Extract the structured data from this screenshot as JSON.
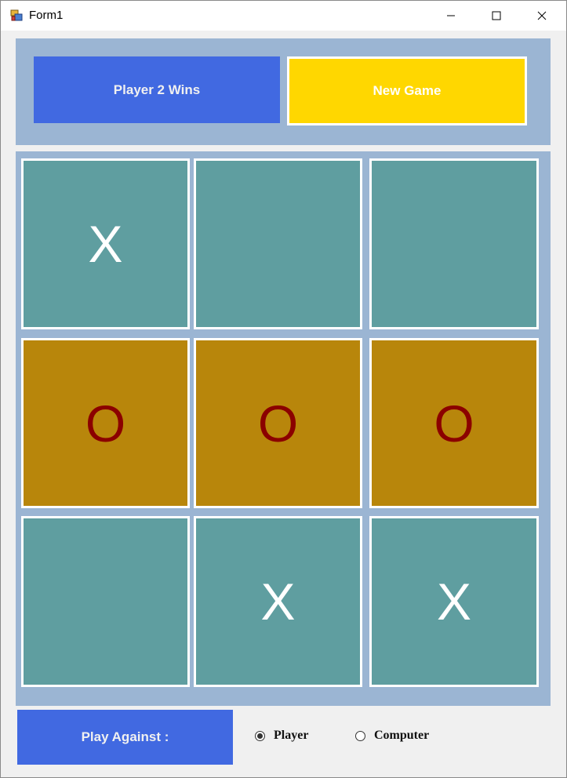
{
  "window": {
    "title": "Form1",
    "icon": "form-app-icon",
    "controls": [
      "minimize-icon",
      "maximize-icon",
      "close-icon"
    ]
  },
  "status": {
    "text": "Player 2 Wins",
    "color": "#4169e1"
  },
  "new_game": {
    "label": "New Game",
    "color": "#ffd700"
  },
  "board": {
    "cells": [
      {
        "mark": "X",
        "highlight": false
      },
      {
        "mark": "",
        "highlight": false
      },
      {
        "mark": "",
        "highlight": false
      },
      {
        "mark": "O",
        "highlight": true
      },
      {
        "mark": "O",
        "highlight": true
      },
      {
        "mark": "O",
        "highlight": true
      },
      {
        "mark": "",
        "highlight": false
      },
      {
        "mark": "X",
        "highlight": false
      },
      {
        "mark": "X",
        "highlight": false
      }
    ],
    "cell_color": "#5f9ea0",
    "win_color": "#b8860b",
    "x_color": "#ffffff",
    "o_color": "#8b0000"
  },
  "play_against": {
    "label": "Play Against :",
    "options": [
      {
        "label": "Player",
        "selected": true
      },
      {
        "label": "Computer",
        "selected": false
      }
    ]
  }
}
